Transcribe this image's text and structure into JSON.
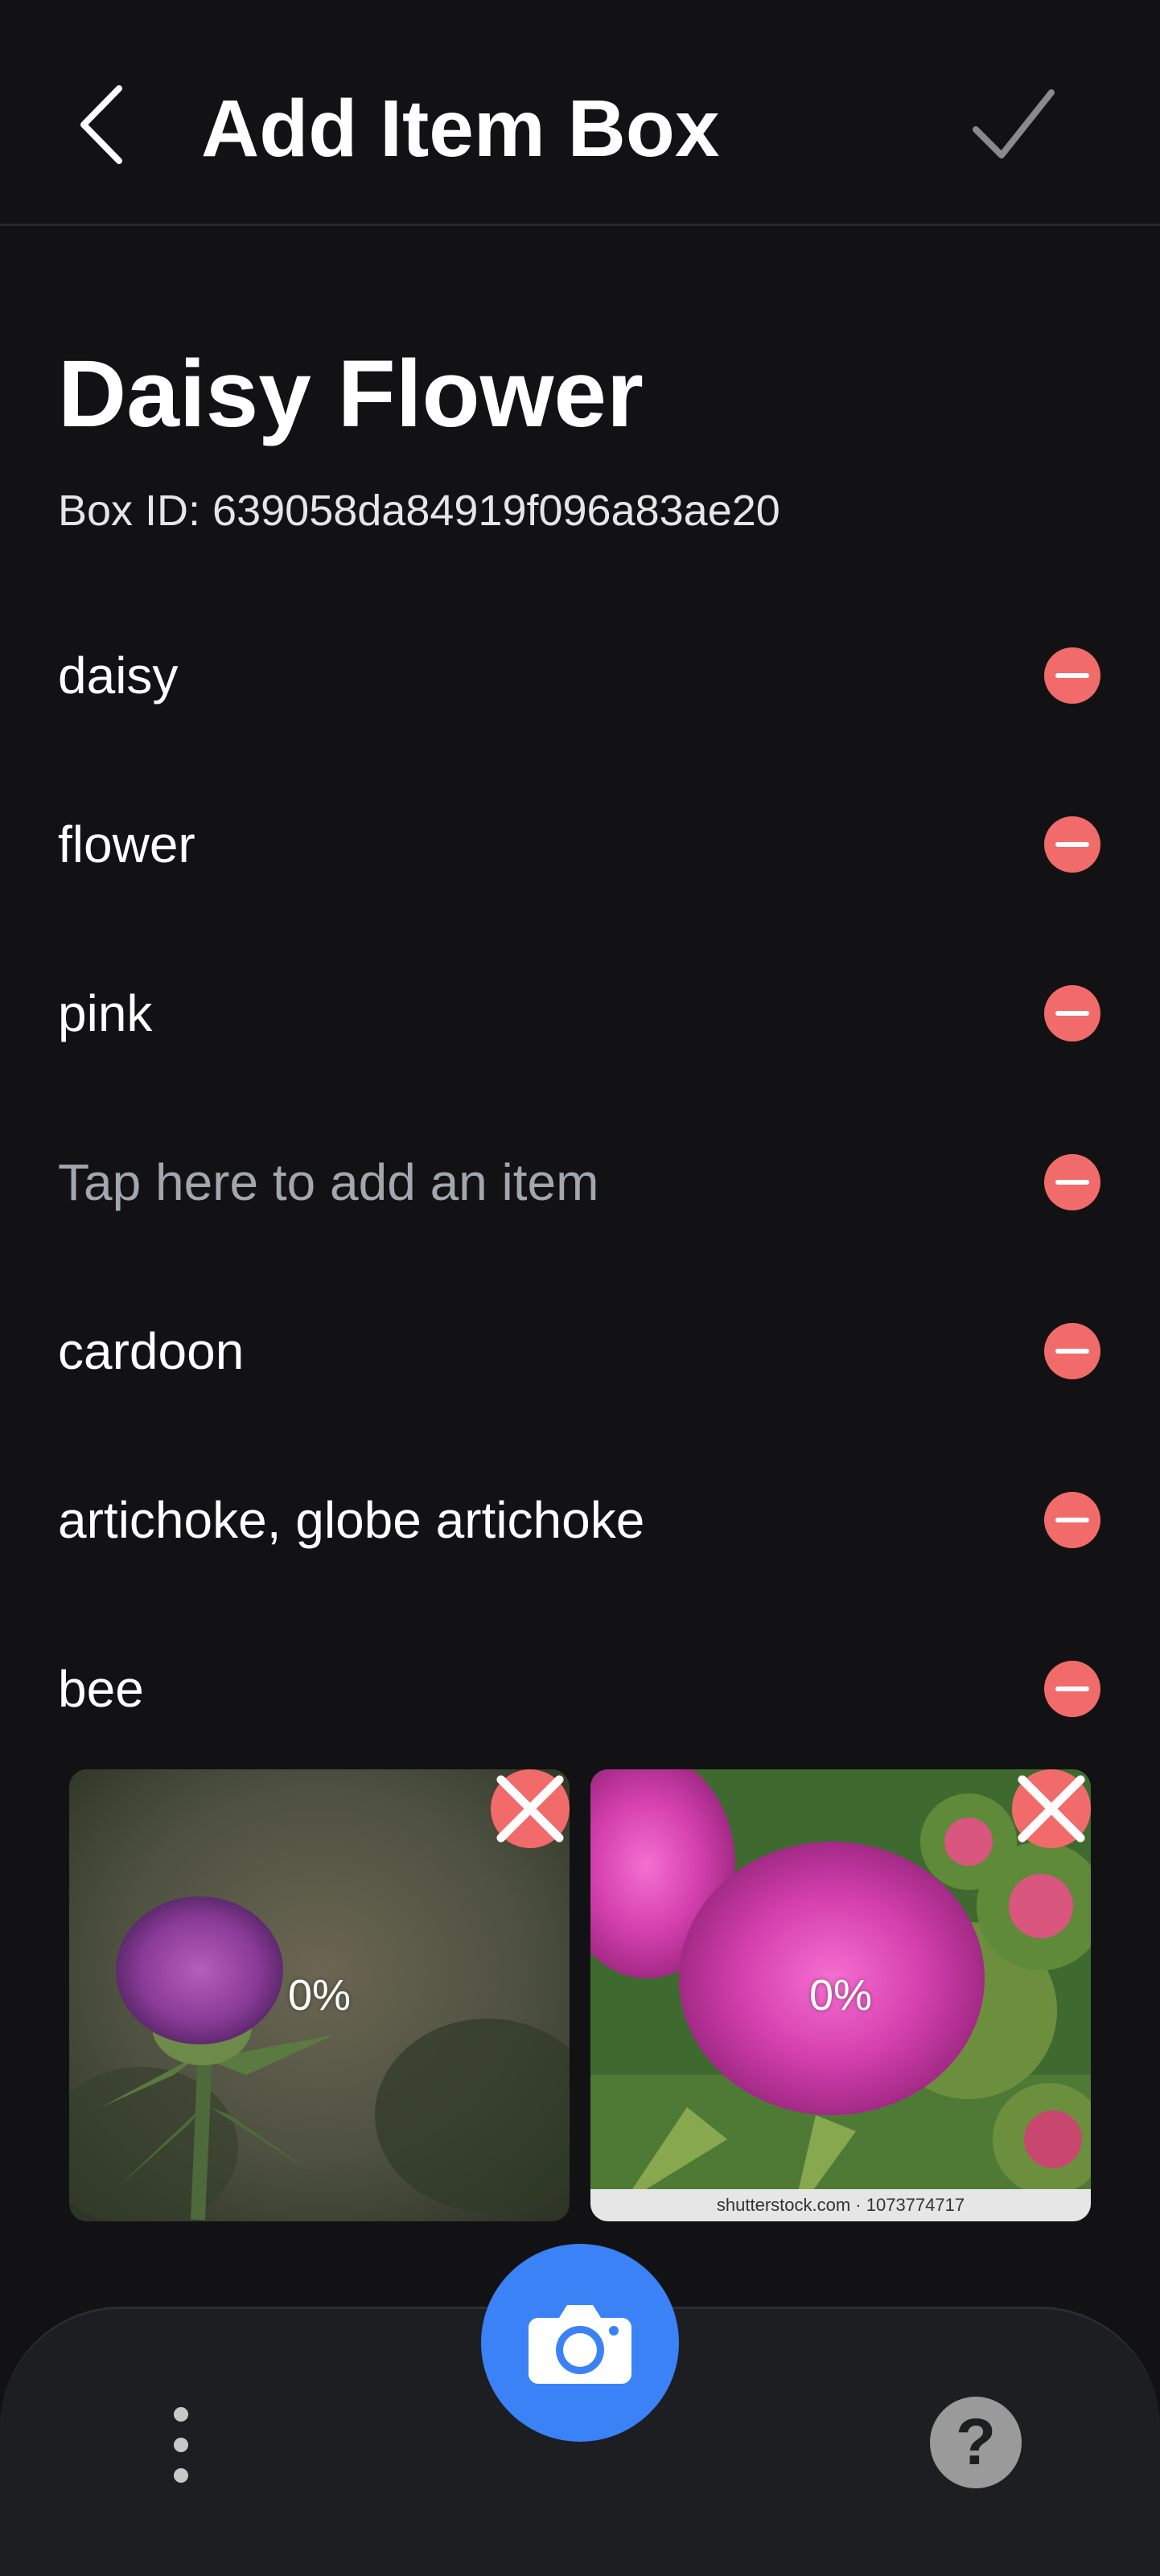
{
  "header": {
    "title": "Add Item Box",
    "back_icon": "chevron-left-icon",
    "confirm_icon": "checkmark-icon"
  },
  "box": {
    "title": "Daisy Flower",
    "id_text": "Box ID: 639058da84919f096a83ae20"
  },
  "items": [
    {
      "label": "daisy",
      "placeholder": false
    },
    {
      "label": "flower",
      "placeholder": false
    },
    {
      "label": "pink",
      "placeholder": false
    },
    {
      "label": "Tap here to add an item",
      "placeholder": true
    },
    {
      "label": "cardoon",
      "placeholder": false
    },
    {
      "label": "artichoke, globe artichoke",
      "placeholder": false
    },
    {
      "label": "bee",
      "placeholder": false
    }
  ],
  "images": [
    {
      "progress": "0%"
    },
    {
      "progress": "0%",
      "watermark": "shutterstock.com · 1073774717"
    }
  ],
  "bottom_bar": {
    "help_label": "?"
  },
  "colors": {
    "background": "#121214",
    "remove": "#f26b6b",
    "camera": "#3a82f6",
    "placeholder_text": "#a2a6ad"
  }
}
